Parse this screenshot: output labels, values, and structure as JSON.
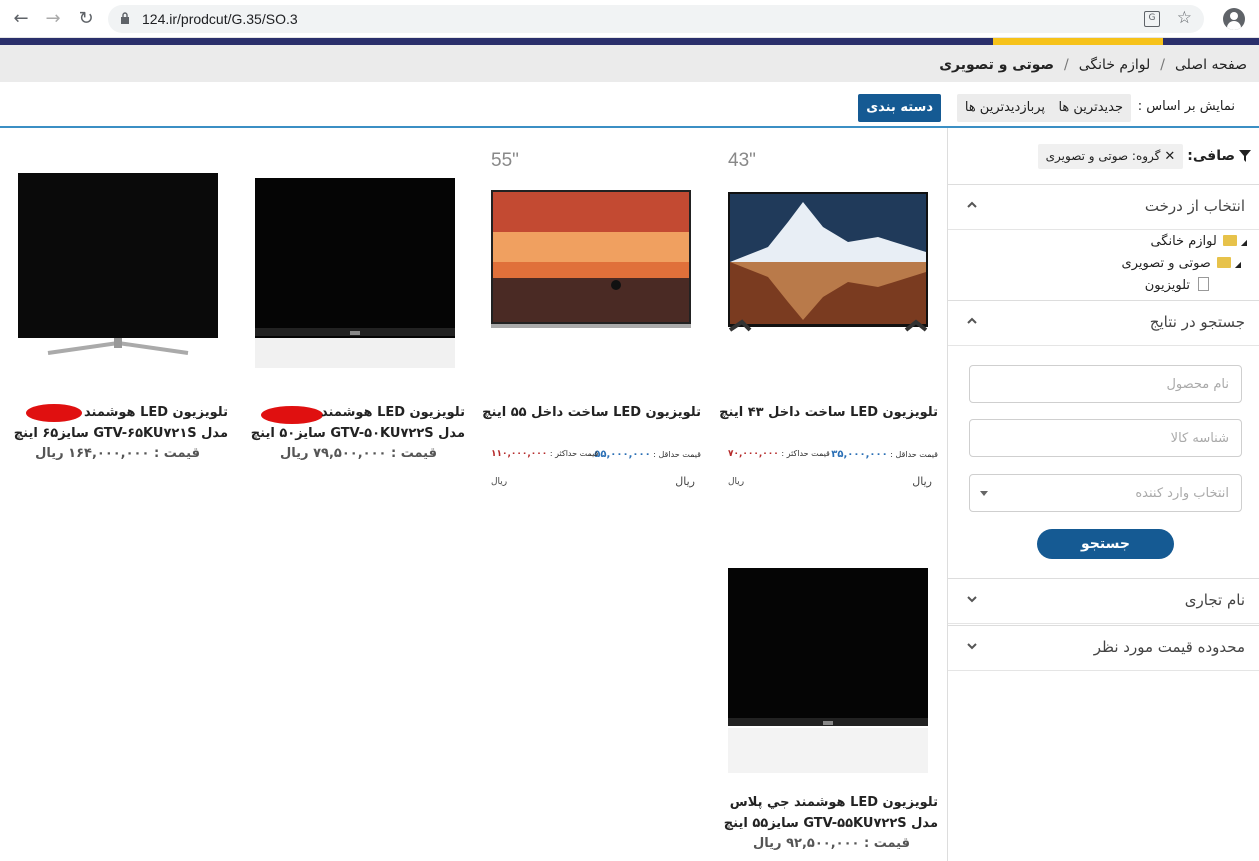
{
  "browser": {
    "url": "124.ir/prodcut/G.35/SO.3"
  },
  "breadcrumb": {
    "items": [
      "صفحه اصلی",
      "لوازم خانگی",
      "صوتی و تصویری"
    ],
    "separator": "/"
  },
  "sort": {
    "label": "نمایش بر اساس :",
    "options": [
      "جدیدترین ها",
      "پربازدیدترین ها",
      "دسته بندی"
    ],
    "active": "دسته بندی"
  },
  "sidebar": {
    "filter_label": "صافی:",
    "chip_text": "گروه: صوتی و تصویری",
    "chip_x": "✕",
    "tree_panel_title": "انتخاب از درخت",
    "tree": [
      "لوازم خانگی",
      "صوتی و تصویری",
      "تلویزیون"
    ],
    "search_panel_title": "جستجو در نتایج",
    "product_name_placeholder": "نام محصول",
    "product_id_placeholder": "شناسه کالا",
    "importer_placeholder": "انتخاب وارد کننده",
    "search_button": "جستجو",
    "brand_panel_title": "نام تجاری",
    "price_panel_title": "محدوده قیمت مورد نظر"
  },
  "products": [
    {
      "name": "تلویزیون LED ساخت داخل ۴۳ اینچ",
      "size_tag": "43\"",
      "min_label": "قیمت حداقل :",
      "min_value": "۳۵,۰۰۰,۰۰۰",
      "max_label": "قیمت حداکثر :",
      "max_value": "۷۰,۰۰۰,۰۰۰",
      "currency": "ریال",
      "currency2": "ریال"
    },
    {
      "name": "تلویزیون LED ساخت داخل ۵۵ اینچ",
      "size_tag": "55\"",
      "min_label": "قیمت حداقل :",
      "min_value": "۵۵,۰۰۰,۰۰۰",
      "max_label": "قیمت حداکثر :",
      "max_value": "۱۱۰,۰۰۰,۰۰۰",
      "currency": "ریال",
      "currency2": "ریال"
    },
    {
      "name_line1": "تلویزیون LED هوشمند",
      "name_line2": "مدل GTV-۵۰KU۷۲۲S سایز۵۰ اینچ",
      "price_label": "قیمت :",
      "price_value": "۷۹,۵۰۰,۰۰۰",
      "currency": "ریال"
    },
    {
      "name_line1": "تلویزیون LED هوشمند",
      "name_line2": "مدل GTV-۶۵KU۷۲۱S سایز۶۵ اینچ",
      "price_label": "قیمت :",
      "price_value": "۱۶۴,۰۰۰,۰۰۰",
      "currency": "ریال"
    },
    {
      "name_line1": "تلویزیون LED هوشمند جي پلاس",
      "name_line2": "مدل GTV-۵۵KU۷۲۲S سایز۵۵ اینچ",
      "price_label": "قیمت :",
      "price_value": "۹۲,۵۰۰,۰۰۰",
      "currency": "ریال"
    }
  ]
}
